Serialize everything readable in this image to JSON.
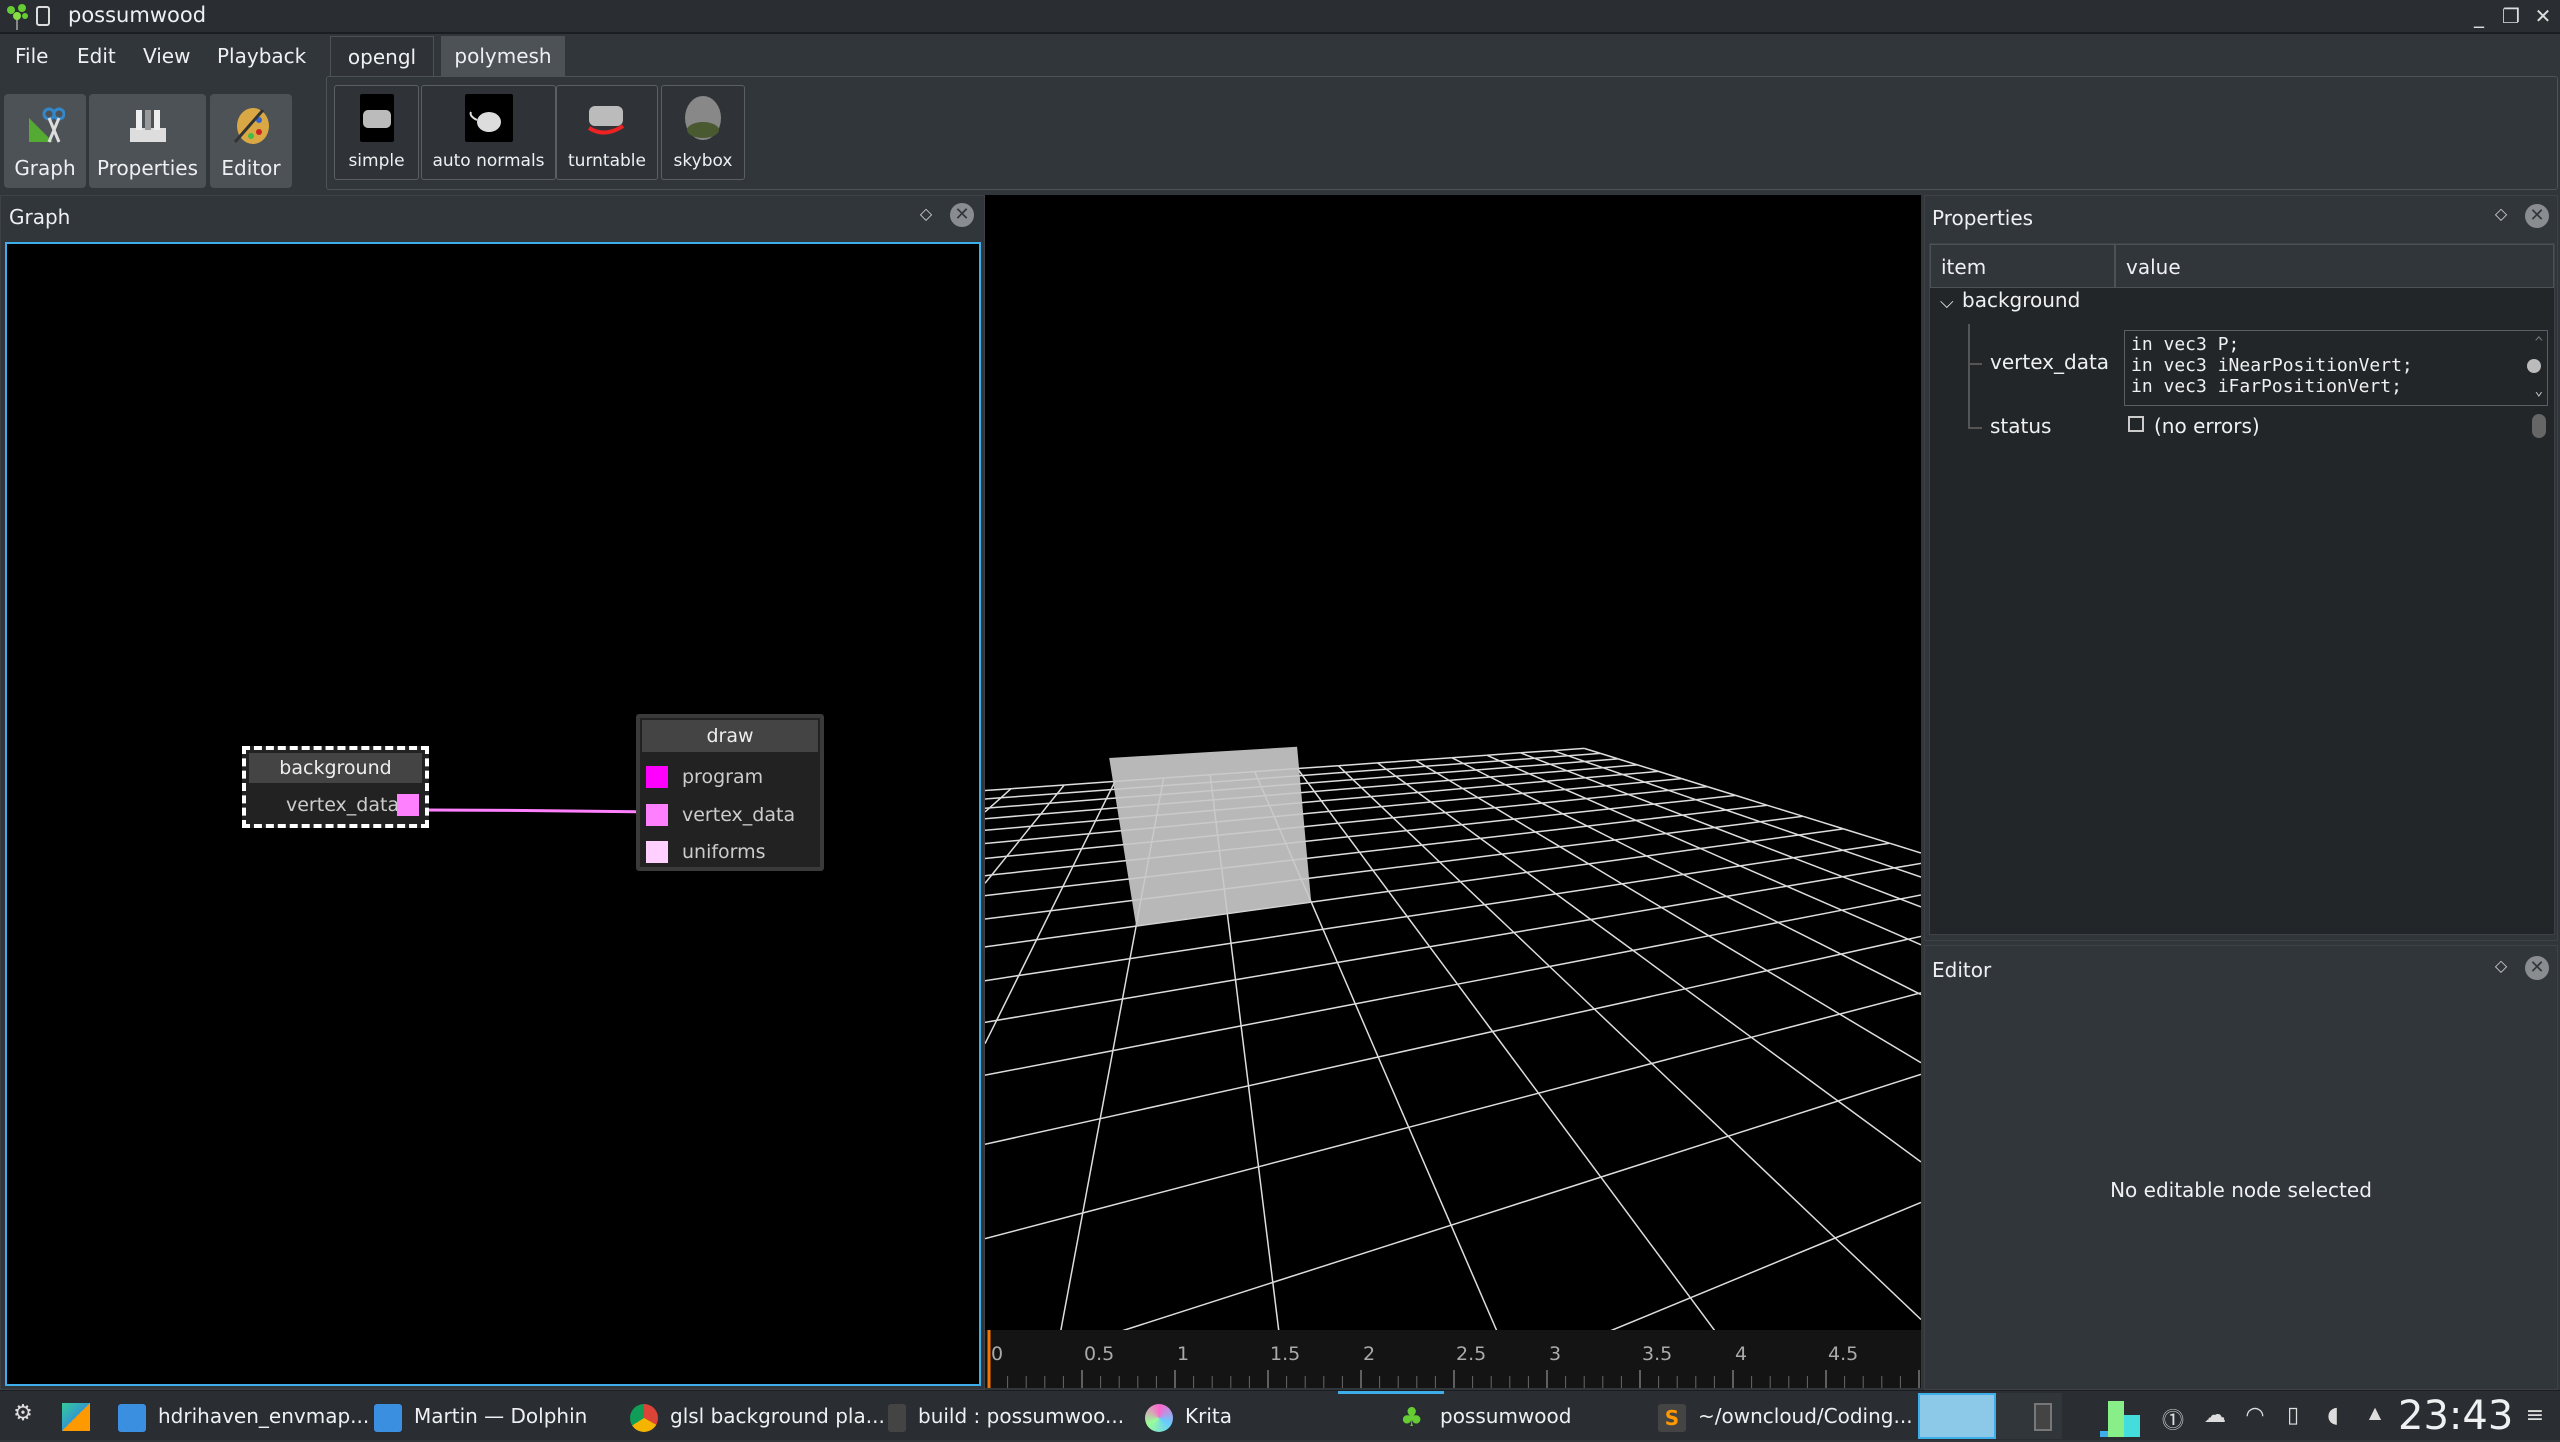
{
  "window": {
    "title": "possumwood"
  },
  "menu": [
    "File",
    "Edit",
    "View",
    "Playback"
  ],
  "dock_buttons": [
    {
      "label": "Graph",
      "icon": "graph-tools-icon"
    },
    {
      "label": "Properties",
      "icon": "properties-icon"
    },
    {
      "label": "Editor",
      "icon": "palette-icon"
    }
  ],
  "tabs": [
    {
      "label": "opengl",
      "active": false
    },
    {
      "label": "polymesh",
      "active": true
    }
  ],
  "presets": [
    {
      "label": "simple",
      "icon": "car-icon"
    },
    {
      "label": "auto normals",
      "icon": "teapot-icon"
    },
    {
      "label": "turntable",
      "icon": "turntable-icon"
    },
    {
      "label": "skybox",
      "icon": "skybox-icon"
    }
  ],
  "graph": {
    "title": "Graph",
    "nodes": [
      {
        "name": "background",
        "ports": [
          {
            "label": "vertex_data",
            "color": "#ff80ff"
          }
        ],
        "selected": true
      },
      {
        "name": "draw",
        "ports": [
          {
            "label": "program",
            "color": "#ff00ff"
          },
          {
            "label": "vertex_data",
            "color": "#ff80ff"
          },
          {
            "label": "uniforms",
            "color": "#ffd0ff"
          }
        ]
      }
    ],
    "connection_color": "#ff80ff"
  },
  "timeline": {
    "labels": [
      "0",
      "0.5",
      "1",
      "1.5",
      "2",
      "2.5",
      "3",
      "3.5",
      "4",
      "4.5"
    ],
    "cursor_color": "#f67400",
    "current": 0
  },
  "properties": {
    "title": "Properties",
    "col_item": "item",
    "col_value": "value",
    "group": "background",
    "rows": [
      {
        "item": "vertex_data",
        "lines": [
          "in vec3 P;",
          "in vec3 iNearPositionVert;",
          "in vec3 iFarPositionVert;"
        ]
      },
      {
        "item": "status",
        "value": "(no errors)"
      }
    ]
  },
  "editor": {
    "title": "Editor",
    "message": "No editable node selected"
  },
  "taskbar": {
    "items": [
      "hdrihaven_envmap...",
      "Martin — Dolphin",
      "glsl background pla...",
      "build : possumwoo...",
      "Krita",
      "possumwood",
      "~/owncloud/Coding..."
    ],
    "active": "possumwood",
    "clock": "23:43",
    "accent": "#3daee9"
  }
}
